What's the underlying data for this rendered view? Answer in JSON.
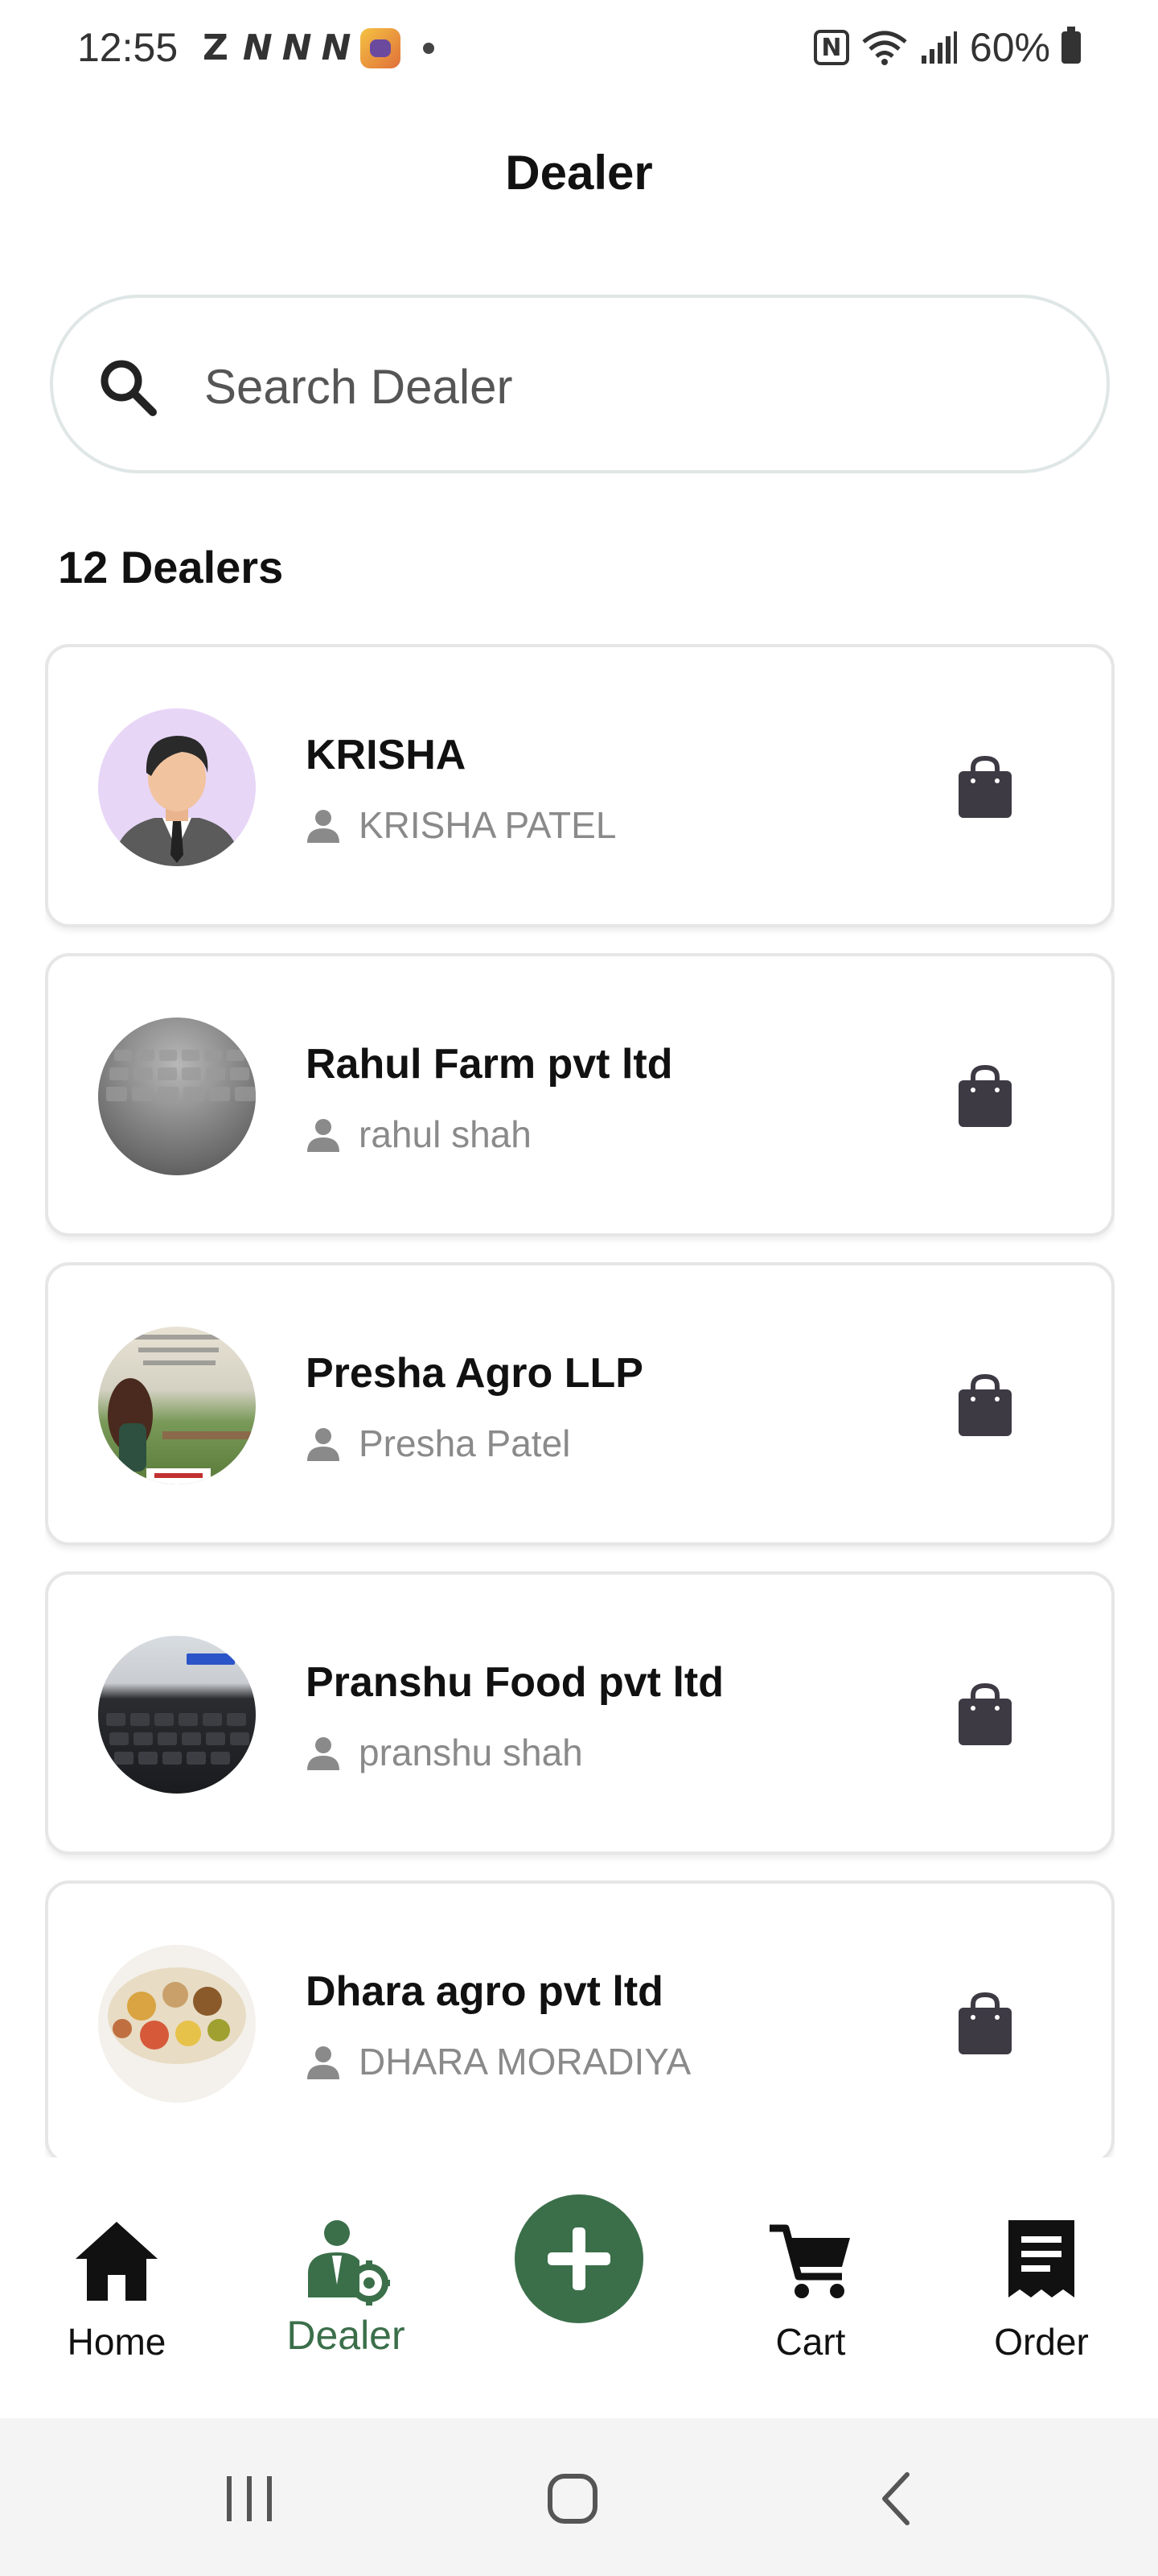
{
  "status_bar": {
    "time": "12:55",
    "notif_z": "Z",
    "notif_n": [
      "N",
      "N",
      "N"
    ],
    "nfc": "N",
    "battery": "60%"
  },
  "header": {
    "title": "Dealer"
  },
  "search": {
    "placeholder": "Search Dealer"
  },
  "list": {
    "count_label": "12 Dealers",
    "dealers": [
      {
        "name": "KRISHA",
        "owner": "KRISHA PATEL"
      },
      {
        "name": "Rahul Farm pvt ltd",
        "owner": "rahul shah"
      },
      {
        "name": "Presha Agro LLP",
        "owner": "Presha Patel"
      },
      {
        "name": "Pranshu Food pvt ltd",
        "owner": "pranshu shah"
      },
      {
        "name": "Dhara agro pvt ltd",
        "owner": "DHARA MORADIYA"
      }
    ]
  },
  "bottom_nav": {
    "home": "Home",
    "dealer": "Dealer",
    "cart": "Cart",
    "order": "Order"
  },
  "colors": {
    "accent": "#3b6f4a",
    "icon_dark": "#3d3a44",
    "owner_text": "#8a8a8a"
  }
}
